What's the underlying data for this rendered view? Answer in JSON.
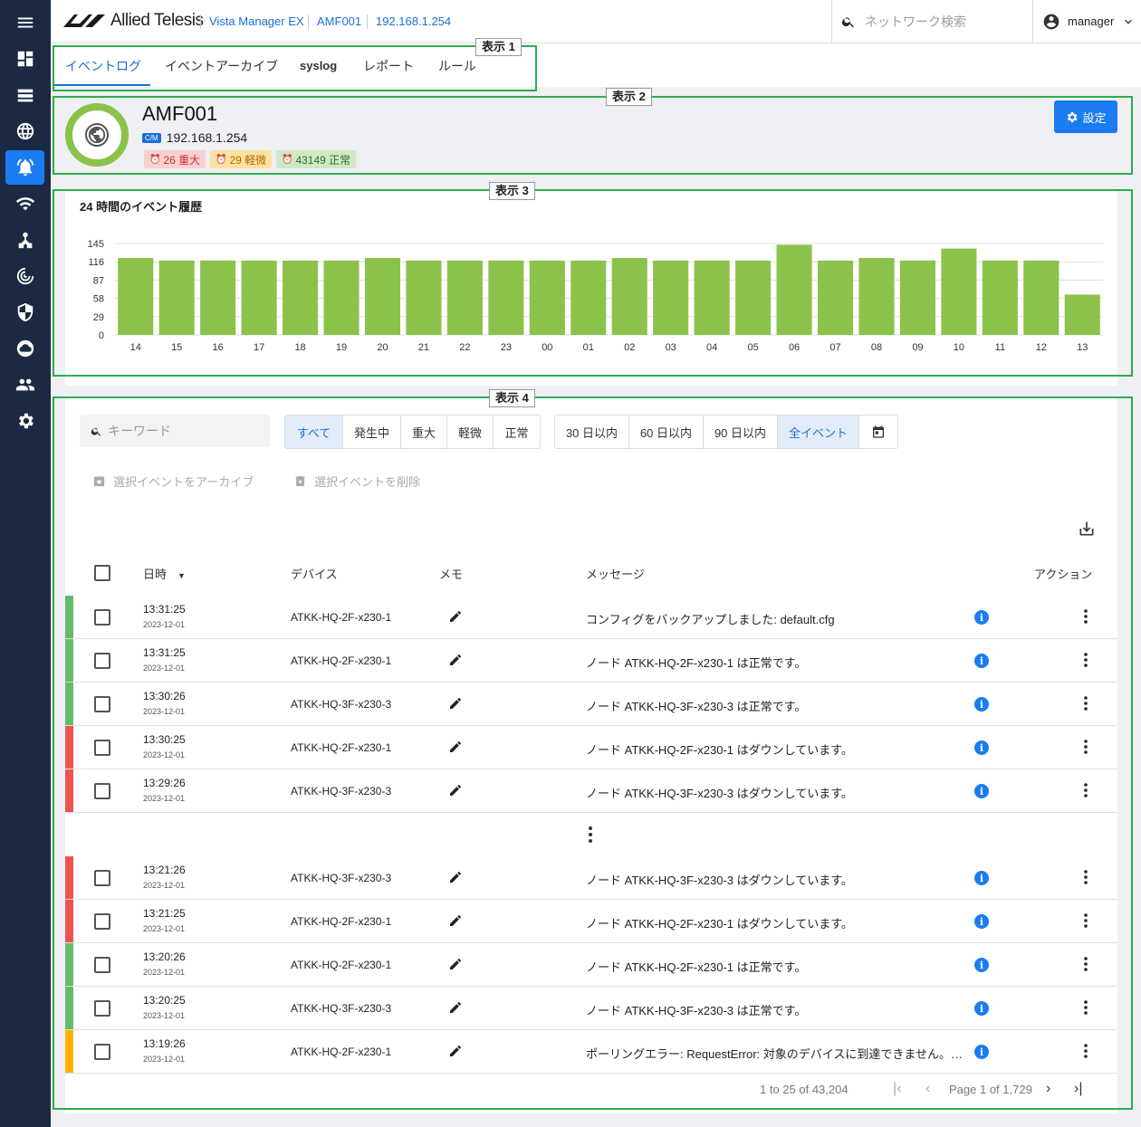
{
  "topbar": {
    "brand": "Allied Telesis",
    "crumbs": [
      "Vista Manager EX",
      "AMF001",
      "192.168.1.254"
    ],
    "search_placeholder": "ネットワーク検索",
    "user": "manager"
  },
  "tabs": [
    "イベントログ",
    "イベントアーカイブ",
    "syslog",
    "レポート",
    "ルール"
  ],
  "annotations": [
    "表示 1",
    "表示 2",
    "表示 3",
    "表示 4"
  ],
  "device": {
    "name": "AMF001",
    "badge": "C/M",
    "ip": "192.168.1.254",
    "critical": "26 重大",
    "minor": "29 軽微",
    "normal": "43149 正常",
    "settings_label": "設定",
    "colors": {
      "critical_bg": "#f9d0d0",
      "critical_fg": "#d32f2f",
      "minor_bg": "#fde2a1",
      "minor_fg": "#b26a00",
      "normal_bg": "#cfe9c7",
      "normal_fg": "#2e6b2e",
      "ring": "#8bc34a"
    }
  },
  "chart_data": {
    "type": "bar",
    "title": "24 時間のイベント履歴",
    "categories": [
      "14",
      "15",
      "16",
      "17",
      "18",
      "19",
      "20",
      "21",
      "22",
      "23",
      "00",
      "01",
      "02",
      "03",
      "04",
      "05",
      "06",
      "07",
      "08",
      "09",
      "10",
      "11",
      "12",
      "13"
    ],
    "values": [
      122,
      118,
      118,
      118,
      118,
      118,
      122,
      118,
      118,
      118,
      118,
      118,
      122,
      118,
      118,
      118,
      143,
      118,
      122,
      118,
      137,
      118,
      118,
      64
    ],
    "yticks": [
      0,
      29,
      58,
      87,
      116,
      145
    ],
    "ylim": [
      0,
      145
    ],
    "color": "#8bc34a"
  },
  "filters": {
    "keyword_placeholder": "キーワード",
    "severity": [
      "すべて",
      "発生中",
      "重大",
      "軽微",
      "正常"
    ],
    "severity_selected": "すべて",
    "period": [
      "30 日以内",
      "60 日以内",
      "90 日以内",
      "全イベント"
    ],
    "period_selected": "全イベント"
  },
  "actions": {
    "archive": "選択イベントをアーカイブ",
    "delete": "選択イベントを削除"
  },
  "table": {
    "headers": {
      "datetime": "日時",
      "device": "デバイス",
      "memo": "メモ",
      "message": "メッセージ",
      "action": "アクション"
    },
    "rows_top": [
      {
        "time": "13:31:25",
        "date": "2023-12-01",
        "device": "ATKK-HQ-2F-x230-1",
        "message": "コンフィグをバックアップしました: default.cfg",
        "severity": "normal"
      },
      {
        "time": "13:31:25",
        "date": "2023-12-01",
        "device": "ATKK-HQ-2F-x230-1",
        "message": "ノード ATKK-HQ-2F-x230-1 は正常です。",
        "severity": "normal"
      },
      {
        "time": "13:30:26",
        "date": "2023-12-01",
        "device": "ATKK-HQ-3F-x230-3",
        "message": "ノード ATKK-HQ-3F-x230-3 は正常です。",
        "severity": "normal"
      },
      {
        "time": "13:30:25",
        "date": "2023-12-01",
        "device": "ATKK-HQ-2F-x230-1",
        "message": "ノード ATKK-HQ-2F-x230-1 はダウンしています。",
        "severity": "critical"
      },
      {
        "time": "13:29:26",
        "date": "2023-12-01",
        "device": "ATKK-HQ-3F-x230-3",
        "message": "ノード ATKK-HQ-3F-x230-3 はダウンしています。",
        "severity": "critical"
      }
    ],
    "rows_bottom": [
      {
        "time": "13:21:26",
        "date": "2023-12-01",
        "device": "ATKK-HQ-3F-x230-3",
        "message": "ノード ATKK-HQ-3F-x230-3 はダウンしています。",
        "severity": "critical"
      },
      {
        "time": "13:21:25",
        "date": "2023-12-01",
        "device": "ATKK-HQ-2F-x230-1",
        "message": "ノード ATKK-HQ-2F-x230-1 はダウンしています。",
        "severity": "critical"
      },
      {
        "time": "13:20:26",
        "date": "2023-12-01",
        "device": "ATKK-HQ-2F-x230-1",
        "message": "ノード ATKK-HQ-2F-x230-1 は正常です。",
        "severity": "normal"
      },
      {
        "time": "13:20:25",
        "date": "2023-12-01",
        "device": "ATKK-HQ-3F-x230-3",
        "message": "ノード ATKK-HQ-3F-x230-3 は正常です。",
        "severity": "normal"
      },
      {
        "time": "13:19:26",
        "date": "2023-12-01",
        "device": "ATKK-HQ-2F-x230-1",
        "message": "ポーリングエラー: RequestError: 対象のデバイスに到達できません。タイムアウト",
        "severity": "minor"
      }
    ],
    "severity_colors": {
      "normal": "#66bb6a",
      "critical": "#ef5350",
      "minor": "#ffb300"
    }
  },
  "pager": {
    "range": "1 to 25 of 43,204",
    "page": "Page 1 of 1,729"
  }
}
